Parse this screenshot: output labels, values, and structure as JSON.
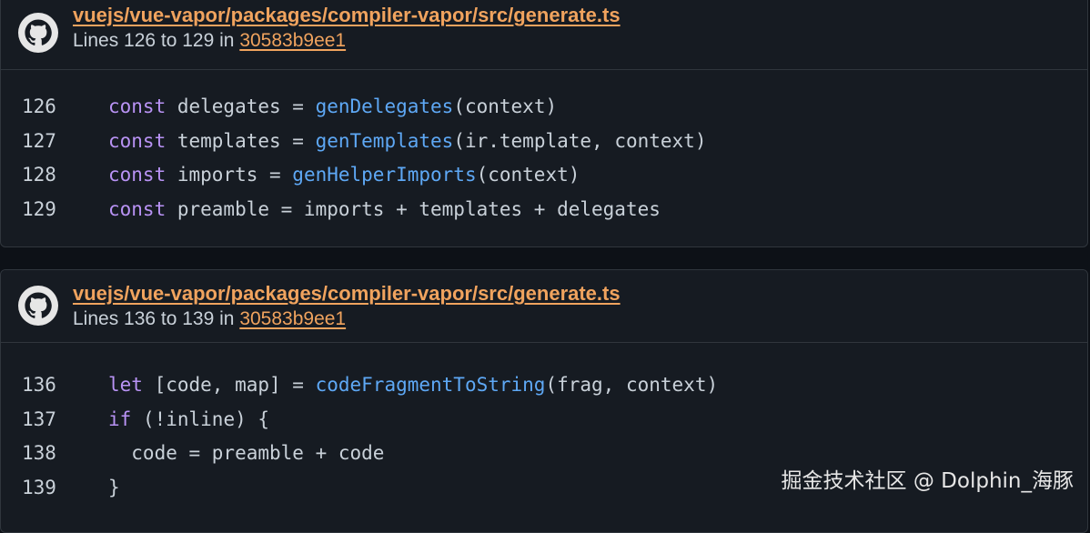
{
  "colors": {
    "background": "#0d1117",
    "card": "#161b22",
    "border": "#30363d",
    "link": "#f0a35e",
    "keyword": "#b993f5",
    "function": "#5ea8f5",
    "text": "#c9d1d9"
  },
  "cards": [
    {
      "icon": "github-icon",
      "file_path": "vuejs/vue-vapor/packages/compiler-vapor/src/generate.ts",
      "lines_text": "Lines 126 to 129 in ",
      "commit": "30583b9ee1",
      "lines": [
        {
          "num": "126",
          "tokens": [
            {
              "t": "const",
              "k": "kw"
            },
            {
              "t": " delegates = ",
              "k": "pl"
            },
            {
              "t": "genDelegates",
              "k": "fn"
            },
            {
              "t": "(context)",
              "k": "pl"
            }
          ]
        },
        {
          "num": "127",
          "tokens": [
            {
              "t": "const",
              "k": "kw"
            },
            {
              "t": " templates = ",
              "k": "pl"
            },
            {
              "t": "genTemplates",
              "k": "fn"
            },
            {
              "t": "(ir.template, context)",
              "k": "pl"
            }
          ]
        },
        {
          "num": "128",
          "tokens": [
            {
              "t": "const",
              "k": "kw"
            },
            {
              "t": " imports = ",
              "k": "pl"
            },
            {
              "t": "genHelperImports",
              "k": "fn"
            },
            {
              "t": "(context)",
              "k": "pl"
            }
          ]
        },
        {
          "num": "129",
          "tokens": [
            {
              "t": "const",
              "k": "kw"
            },
            {
              "t": " preamble = imports + templates + delegates",
              "k": "pl"
            }
          ]
        }
      ]
    },
    {
      "icon": "github-icon",
      "file_path": "vuejs/vue-vapor/packages/compiler-vapor/src/generate.ts",
      "lines_text": "Lines 136 to 139 in ",
      "commit": "30583b9ee1",
      "lines": [
        {
          "num": "136",
          "tokens": [
            {
              "t": "let",
              "k": "kw"
            },
            {
              "t": " [code, map] = ",
              "k": "pl"
            },
            {
              "t": "codeFragmentToString",
              "k": "fn"
            },
            {
              "t": "(frag, context)",
              "k": "pl"
            }
          ]
        },
        {
          "num": "137",
          "tokens": [
            {
              "t": "if",
              "k": "kw"
            },
            {
              "t": " (!inline) {",
              "k": "pl"
            }
          ]
        },
        {
          "num": "138",
          "tokens": [
            {
              "t": "  code = preamble + code",
              "k": "pl"
            }
          ]
        },
        {
          "num": "139",
          "tokens": [
            {
              "t": "}",
              "k": "pl"
            }
          ]
        }
      ]
    }
  ],
  "watermark": "掘金技术社区 @ Dolphin_海豚"
}
